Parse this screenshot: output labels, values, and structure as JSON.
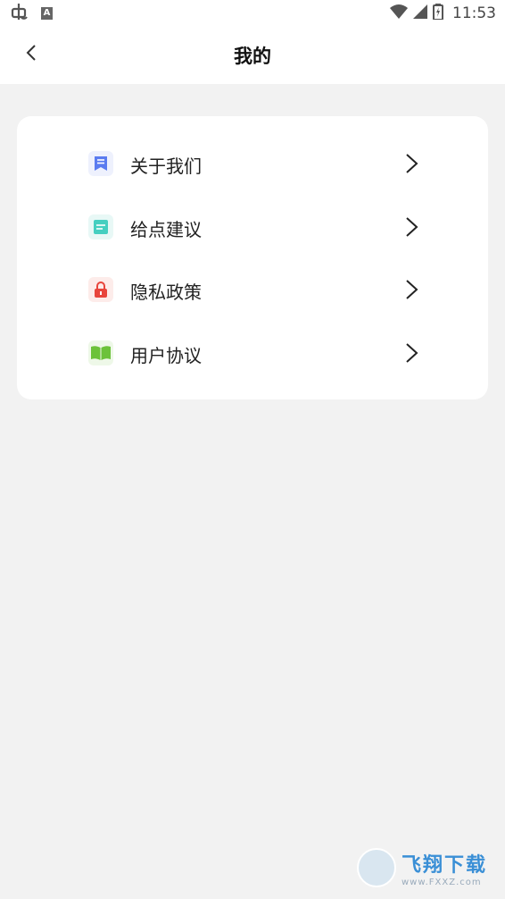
{
  "status_bar": {
    "time": "11:53",
    "left_icons": [
      "bug-icon",
      "notification-a-icon"
    ],
    "notif_letter": "A",
    "right_icons": [
      "wifi-icon",
      "signal-icon",
      "battery-icon"
    ]
  },
  "header": {
    "title": "我的",
    "back_icon": "chevron-left-icon"
  },
  "menu": {
    "items": [
      {
        "label": "关于我们",
        "icon": "bookmark-doc-icon",
        "icon_color": "#5b7cf0",
        "icon_bg": "#eef1fd"
      },
      {
        "label": "给点建议",
        "icon": "note-icon",
        "icon_color": "#45cfc0",
        "icon_bg": "#e8f8f6"
      },
      {
        "label": "隐私政策",
        "icon": "lock-icon",
        "icon_color": "#e8453c",
        "icon_bg": "#fdecea"
      },
      {
        "label": "用户协议",
        "icon": "open-book-icon",
        "icon_color": "#6cc23a",
        "icon_bg": "#eef8e8"
      }
    ]
  },
  "watermark": {
    "main": "飞翔下载",
    "sub": "www.FXXZ.com"
  },
  "colors": {
    "background": "#f2f2f2",
    "card": "#ffffff",
    "text": "#222222"
  }
}
